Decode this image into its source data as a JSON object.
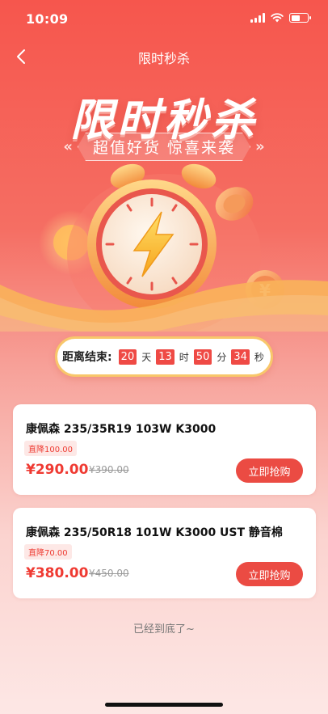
{
  "status_bar": {
    "time": "10:09"
  },
  "nav": {
    "title": "限时秒杀"
  },
  "banner": {
    "title": "限时秒杀",
    "subtitle": "超值好货 惊喜来袭"
  },
  "countdown": {
    "label": "距离结束:",
    "days": "20",
    "days_unit": "天",
    "hours": "13",
    "hours_unit": "时",
    "minutes": "50",
    "minutes_unit": "分",
    "seconds": "34",
    "seconds_unit": "秒"
  },
  "products": [
    {
      "name": "康佩森 235/35R19 103W K3000",
      "discount": "直降100.00",
      "price": "¥290.00",
      "original_price": "¥390.00",
      "button": "立即抢购"
    },
    {
      "name": "康佩森 235/50R18 101W K3000 UST 静音棉",
      "discount": "直降70.00",
      "price": "¥380.00",
      "original_price": "¥450.00",
      "button": "立即抢购"
    }
  ],
  "footer": {
    "tip": "已经到底了~"
  },
  "colors": {
    "primary": "#eb4b43",
    "price": "#ef3a32",
    "badge_bg": "#fde8e6",
    "gold": "#f8c76b"
  }
}
